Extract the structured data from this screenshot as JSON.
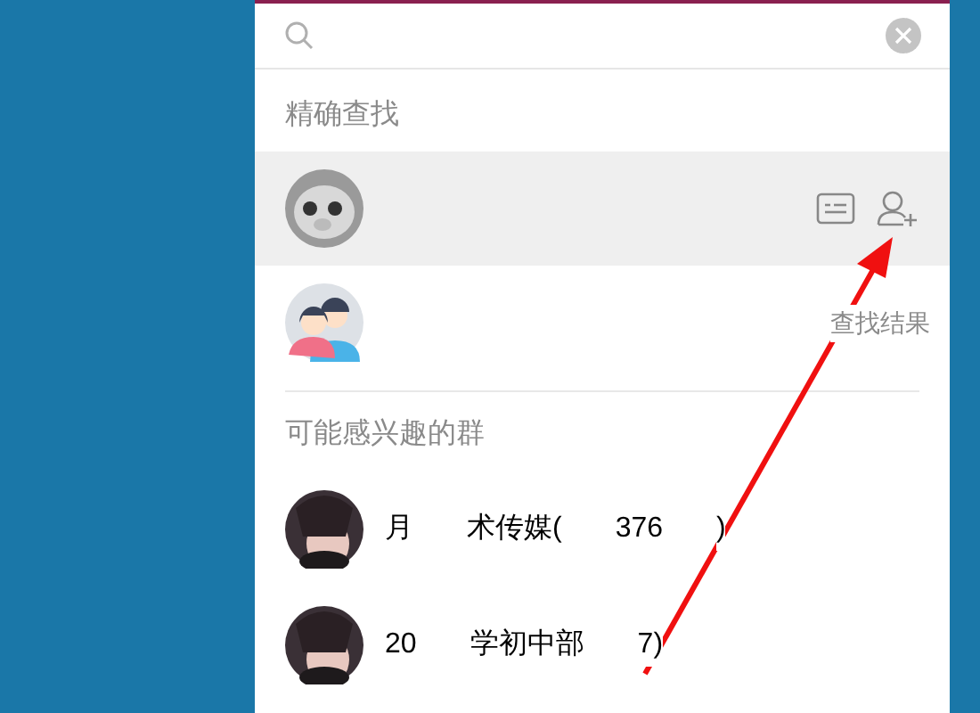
{
  "exact_section": {
    "title": "精确查找",
    "results": [
      {
        "selected": true
      },
      {
        "selected": false,
        "caption": "查找结果"
      }
    ]
  },
  "groups_section": {
    "title": "可能感兴趣的群",
    "groups": [
      {
        "name_parts": [
          "月",
          "术传媒(",
          "376",
          ")"
        ]
      },
      {
        "name_parts": [
          "20",
          "学初中部",
          "7)"
        ]
      }
    ]
  }
}
